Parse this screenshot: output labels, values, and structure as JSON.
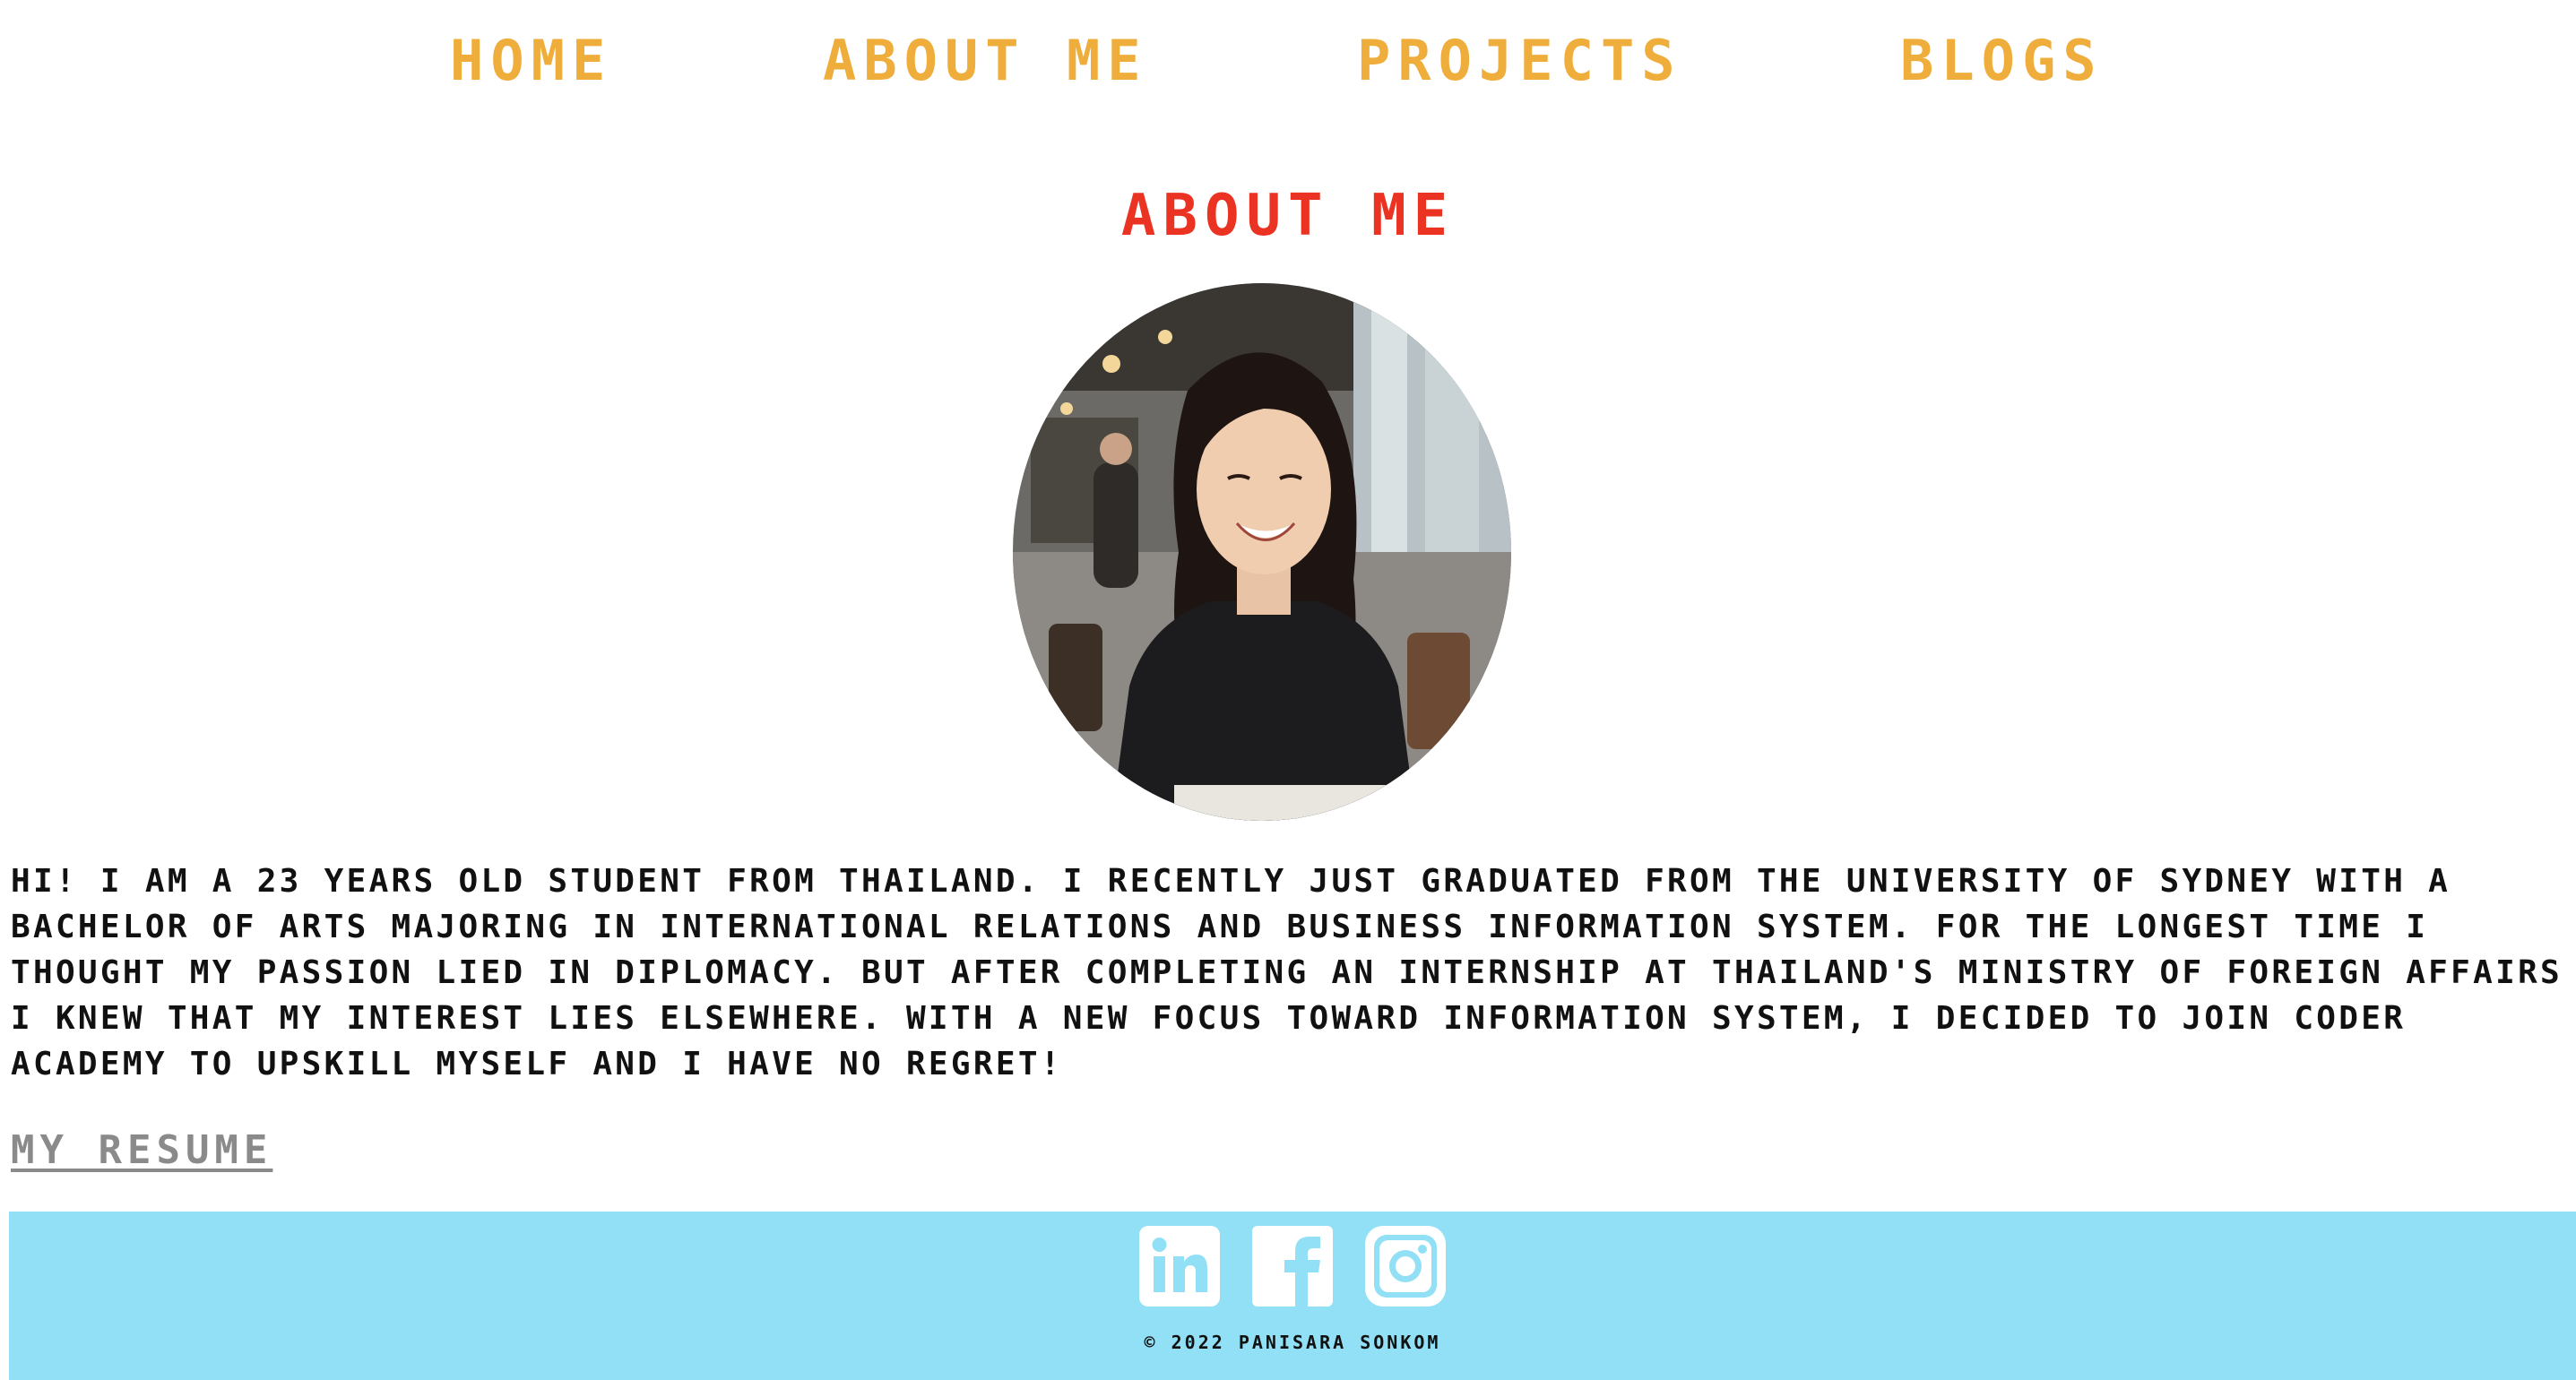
{
  "nav": {
    "home": "Home",
    "about": "About me",
    "projects": "Projects",
    "blogs": "Blogs"
  },
  "main": {
    "heading": "About me",
    "bio": "Hi! I am a 23 years old student from Thailand. I recently just graduated from the University of Sydney with a Bachelor of Arts majoring in International Relations and Business Information System. For the longest time I thought my passion lied in diplomacy. But after completing an internship at Thailand's Ministry of Foreign Affairs I knew that my interest lies elsewhere. With a new focus toward Information System, I decided to join Coder Academy to upskill myself and I have no regret!",
    "resume_label": "My Resume"
  },
  "footer": {
    "social": [
      {
        "name": "linkedin-icon"
      },
      {
        "name": "facebook-icon"
      },
      {
        "name": "instagram-icon"
      }
    ],
    "copyright": "© 2022 Panisara Sonkom"
  },
  "colors": {
    "nav": "#efae3c",
    "heading": "#ea3323",
    "footer_bg": "#92e0f5",
    "resume": "#8a8a8a"
  }
}
